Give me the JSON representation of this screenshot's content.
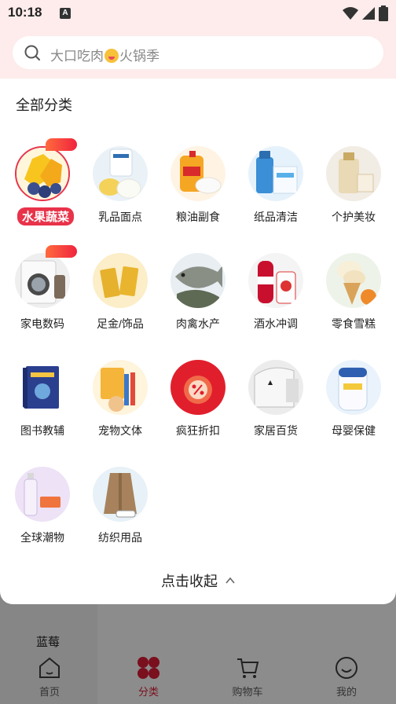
{
  "status_bar": {
    "time": "10:18",
    "notification": "A"
  },
  "search": {
    "placeholder_before": "大口吃肉",
    "placeholder_after": "火锅季"
  },
  "panel": {
    "title": "全部分类",
    "collapse_label": "点击收起"
  },
  "categories": [
    {
      "label": "水果蔬菜",
      "selected": true,
      "badge": true
    },
    {
      "label": "乳品面点"
    },
    {
      "label": "粮油副食"
    },
    {
      "label": "纸品清洁"
    },
    {
      "label": "个护美妆"
    },
    {
      "label": "家电数码",
      "badge": true
    },
    {
      "label": "足金/饰品"
    },
    {
      "label": "肉禽水产"
    },
    {
      "label": "酒水冲调"
    },
    {
      "label": "零食雪糕"
    },
    {
      "label": "图书教辅"
    },
    {
      "label": "宠物文体"
    },
    {
      "label": "疯狂折扣"
    },
    {
      "label": "家居百货"
    },
    {
      "label": "母婴保健"
    },
    {
      "label": "全球潮物"
    },
    {
      "label": "纺织用品"
    }
  ],
  "background": {
    "side_label": "蓝莓"
  },
  "bottom_nav": [
    {
      "label": "首页"
    },
    {
      "label": "分类",
      "active": true
    },
    {
      "label": "购物车"
    },
    {
      "label": "我的"
    }
  ],
  "colors": {
    "accent": "#e8334a",
    "header_bg": "#fdeceb",
    "nav_active": "#7a0f1e"
  }
}
